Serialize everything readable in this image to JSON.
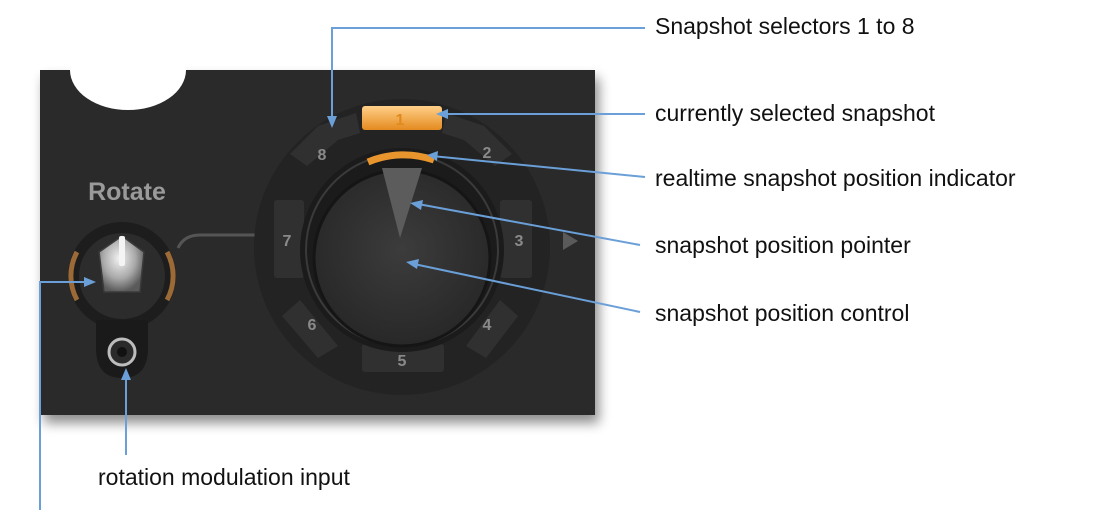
{
  "panel": {
    "section_label": "Rotate",
    "selected_snapshot": "1",
    "snapshot_selectors": [
      "1",
      "2",
      "3",
      "4",
      "5",
      "6",
      "7",
      "8"
    ],
    "colors": {
      "panel_bg": "#2b2b2b",
      "accent_orange": "#f0a040",
      "label_gray": "#9a9a9a",
      "callout_line": "#6a9fd8"
    }
  },
  "callouts": {
    "snapshot_selectors": "Snapshot selectors 1 to 8",
    "selected_snapshot": "currently selected snapshot",
    "position_indicator": "realtime snapshot position indicator",
    "position_pointer": "snapshot position pointer",
    "position_control": "snapshot position control",
    "modulation_input": "rotation modulation input"
  }
}
